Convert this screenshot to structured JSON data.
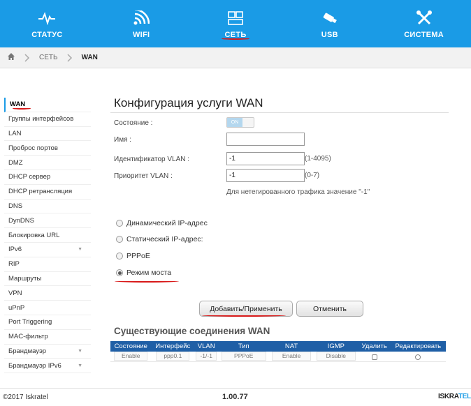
{
  "topnav": {
    "items": [
      {
        "label": "СТАТУС",
        "icon": "pulse-icon"
      },
      {
        "label": "WIFI",
        "icon": "wifi-icon"
      },
      {
        "label": "СЕТЬ",
        "icon": "network-icon",
        "active": true
      },
      {
        "label": "USB",
        "icon": "usb-icon"
      },
      {
        "label": "СИСТЕМА",
        "icon": "tools-icon"
      }
    ],
    "color": "#1a9be6"
  },
  "breadcrumb": {
    "home_icon": "home-icon",
    "items": [
      "СЕТЬ",
      "WAN"
    ]
  },
  "sidebar": {
    "items": [
      {
        "label": "WAN",
        "active": true
      },
      {
        "label": "Группы интерфейсов"
      },
      {
        "label": "LAN"
      },
      {
        "label": "Проброс портов"
      },
      {
        "label": "DMZ"
      },
      {
        "label": "DHCP сервер"
      },
      {
        "label": "DHCP ретрансляция"
      },
      {
        "label": "DNS"
      },
      {
        "label": "DynDNS"
      },
      {
        "label": "Блокировка URL"
      },
      {
        "label": "IPv6",
        "expandable": true
      },
      {
        "label": "RIP"
      },
      {
        "label": "Маршруты"
      },
      {
        "label": "VPN"
      },
      {
        "label": "uPnP"
      },
      {
        "label": "Port Triggering"
      },
      {
        "label": "MAC-фильтр"
      },
      {
        "label": "Брандмауэр",
        "expandable": true
      },
      {
        "label": "Брандмауэр IPv6",
        "expandable": true
      }
    ]
  },
  "main": {
    "title": "Конфигурация услуги WAN",
    "state_label": "Состояние :",
    "state_toggle": "ON",
    "name_label": "Имя :",
    "name_value": "",
    "vlan_id_label": "Идентификатор VLAN :",
    "vlan_id_value": "-1",
    "vlan_id_hint": "(1-4095)",
    "vlan_prio_label": "Приоритет VLAN :",
    "vlan_prio_value": "-1",
    "vlan_prio_hint": "(0-7)",
    "untagged_note": "Для нетегированного трафика значение \"-1\"",
    "modes": [
      {
        "label": "Динамический IP-адрес",
        "checked": false
      },
      {
        "label": "Статический IP-адрес:",
        "checked": false
      },
      {
        "label": "PPPoE",
        "checked": false
      },
      {
        "label": "Режим моста",
        "checked": true
      }
    ],
    "apply_button": "Добавить/Применить",
    "cancel_button": "Отменить"
  },
  "connections": {
    "title": "Существующие соединения WAN",
    "columns": [
      "Состояние",
      "Интерфейс",
      "VLAN",
      "Тип",
      "NAT",
      "IGMP",
      "Удалить",
      "Редактировать"
    ],
    "rows": [
      {
        "state": "Enable",
        "interface": "ppp0.1",
        "vlan": "-1/-1",
        "type": "PPPoE",
        "nat": "Enable",
        "igmp": "Disable"
      }
    ],
    "header_color": "#1f5fa6"
  },
  "footer": {
    "copyright": "©2017 Iskratel",
    "version": "1.00.77",
    "brand_a": "ISKRA",
    "brand_b": "TEL"
  }
}
